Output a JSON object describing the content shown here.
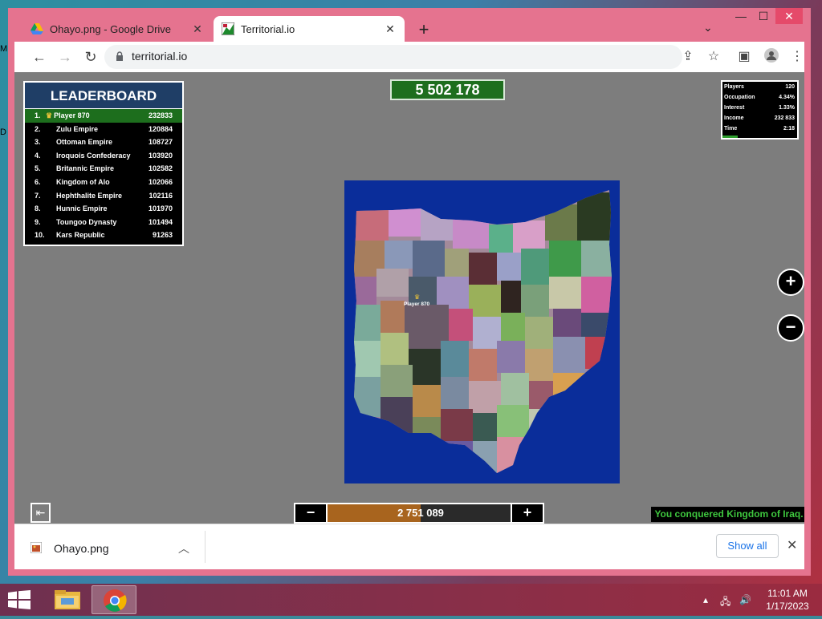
{
  "desktop": {
    "left_labels": [
      "M",
      "D"
    ]
  },
  "browser": {
    "tabs": [
      {
        "title": "Ohayo.png - Google Drive",
        "close": "✕",
        "active": false
      },
      {
        "title": "Territorial.io",
        "close": "✕",
        "active": true
      }
    ],
    "new_tab": "+",
    "tab_search": "⌄",
    "window_controls": {
      "minimize": "—",
      "maximize": "☐",
      "close": "✕"
    },
    "url": "territorial.io"
  },
  "game": {
    "leaderboard": {
      "title": "LEADERBOARD",
      "rows": [
        {
          "rank": "1.",
          "name": "Player 870",
          "value": "232833"
        },
        {
          "rank": "2.",
          "name": "Zulu Empire",
          "value": "120884"
        },
        {
          "rank": "3.",
          "name": "Ottoman Empire",
          "value": "108727"
        },
        {
          "rank": "4.",
          "name": "Iroquois Confederacy",
          "value": "103920"
        },
        {
          "rank": "5.",
          "name": "Britannic Empire",
          "value": "102582"
        },
        {
          "rank": "6.",
          "name": "Kingdom of Alo",
          "value": "102066"
        },
        {
          "rank": "7.",
          "name": "Hephthalite Empire",
          "value": "102116"
        },
        {
          "rank": "8.",
          "name": "Hunnic Empire",
          "value": "101970"
        },
        {
          "rank": "9.",
          "name": "Toungoo Dynasty",
          "value": "101494"
        },
        {
          "rank": "10.",
          "name": "Kars Republic",
          "value": "91263"
        }
      ]
    },
    "population": "5 502 178",
    "stats": [
      {
        "label": "Players",
        "value": "120"
      },
      {
        "label": "Occupation",
        "value": "4.34%"
      },
      {
        "label": "Interest",
        "value": "1.33%"
      },
      {
        "label": "Income",
        "value": "232 833"
      },
      {
        "label": "Time",
        "value": "2:18"
      }
    ],
    "zoom_in": "+",
    "zoom_out": "−",
    "player_label": "Player 870",
    "attack_slider": {
      "minus": "−",
      "plus": "+",
      "value": "2 751 089",
      "fill_fraction": 0.5
    },
    "message": "You conquered Kingdom of Iraq.",
    "colors": {
      "ocean": "#0a2d9a",
      "leader": "#1d6e1d",
      "population_bg": "#1e6e1e",
      "slider_fill": "#a8641e",
      "message_text": "#3ec63e"
    }
  },
  "download_bar": {
    "file_name": "Ohayo.png",
    "show_all": "Show all",
    "close": "✕"
  },
  "taskbar": {
    "time": "11:01 AM",
    "date": "1/17/2023"
  }
}
